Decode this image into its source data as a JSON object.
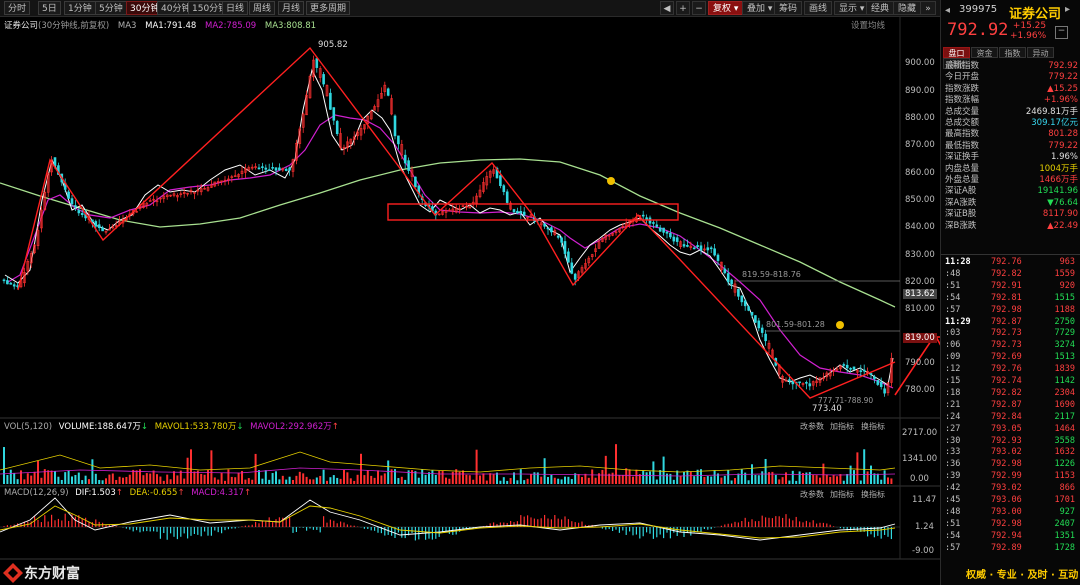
{
  "toolbar": {
    "period_tabs": [
      "分时",
      "5日",
      "1分钟",
      "5分钟",
      "30分钟",
      "40分钟",
      "150分钟",
      "日线",
      "周线",
      "月线",
      "更多周期"
    ],
    "active_tab": "30分钟",
    "tools": [
      "复权",
      "叠加",
      "筹码",
      "画线",
      "显示",
      "经典"
    ],
    "zoom_label": "隐藏"
  },
  "main_chart": {
    "title": "证券公司",
    "subtitle": "(30分钟线,前复权)",
    "ma_label": "MA3",
    "ma1": "MA1:791.48",
    "ma2": "MA2:785.09",
    "ma3": "MA3:808.81",
    "settings": "设置均线",
    "y_ticks": [
      "900.00",
      "890.00",
      "880.00",
      "870.00",
      "860.00",
      "850.00",
      "840.00",
      "830.00",
      "820.00",
      "810.00",
      "800.00",
      "790.00",
      "780.00"
    ],
    "high_label": "905.82",
    "low_label": "773.40",
    "low_label2": "777.71-788.90",
    "range1": "819.59-818.76",
    "range2": "801.59-801.28",
    "price_tag_1": "813.62",
    "price_tag_2": "819.00",
    "colors": {
      "ma1": "#ffffff",
      "ma2": "#d020d0",
      "ma3": "#a8e090",
      "up": "#ff3030",
      "down": "#30d8e0",
      "annotation": "#ff2020"
    }
  },
  "vol_panel": {
    "label": "VOL(5,120)",
    "volume": "VOLUME:188.647万",
    "mavol1": "MAVOL1:533.780万",
    "mavol2": "MAVOL2:292.962万",
    "y_ticks": [
      "2717.00",
      "1341.00",
      "0.00"
    ],
    "buttons": [
      "改参数",
      "加指标",
      "换指标"
    ]
  },
  "macd_panel": {
    "label": "MACD(12,26,9)",
    "dif": "DIF:1.503",
    "dea": "DEA:-0.655",
    "macd": "MACD:4.317",
    "y_ticks": [
      "11.47",
      "1.24",
      "-9.00"
    ],
    "buttons": [
      "改参数",
      "加指标",
      "换指标"
    ]
  },
  "right_panel": {
    "code": "399975",
    "name": "证券公司",
    "price": "792.92",
    "change": "+15.25",
    "change_pct": "+1.96%",
    "subtabs": [
      "盘口",
      "资金",
      "指数",
      "异动",
      "领张"
    ],
    "stats": [
      {
        "k": "最新指数",
        "v": "792.92",
        "c": "red"
      },
      {
        "k": "今日开盘",
        "v": "779.22",
        "c": "red"
      },
      {
        "k": "指数涨跌",
        "v": "▲15.25",
        "c": "red"
      },
      {
        "k": "指数涨幅",
        "v": "+1.96%",
        "c": "red"
      },
      {
        "k": "总成交量",
        "v": "2469.81万手",
        "c": "wht"
      },
      {
        "k": "总成交额",
        "v": "309.17亿元",
        "c": "cyan"
      },
      {
        "k": "最高指数",
        "v": "801.28",
        "c": "red"
      },
      {
        "k": "最低指数",
        "v": "779.22",
        "c": "red"
      },
      {
        "k": "深证换手",
        "v": "1.96%",
        "c": "wht"
      },
      {
        "k": "内盘总量",
        "v": "1004万手",
        "c": "yel"
      },
      {
        "k": "外盘总量",
        "v": "1466万手",
        "c": "red"
      },
      {
        "k": "深证A股",
        "v": "19141.96",
        "c": "grn"
      },
      {
        "k": "深A涨跌",
        "v": "▼76.64",
        "c": "grn"
      },
      {
        "k": "深证B股",
        "v": "8117.90",
        "c": "red"
      },
      {
        "k": "深B涨跌",
        "v": "▲22.49",
        "c": "red"
      }
    ],
    "ticks": [
      {
        "t": "11:28",
        "p": "792.76",
        "v": "963",
        "c": "red",
        "b": true
      },
      {
        "t": ":48",
        "p": "792.82",
        "v": "1559",
        "c": "red"
      },
      {
        "t": ":51",
        "p": "792.91",
        "v": "920",
        "c": "red"
      },
      {
        "t": ":54",
        "p": "792.81",
        "v": "1515",
        "c": "grn"
      },
      {
        "t": ":57",
        "p": "792.98",
        "v": "1188",
        "c": "red"
      },
      {
        "t": "11:29",
        "p": "792.87",
        "v": "2750",
        "c": "grn",
        "b": true
      },
      {
        "t": ":03",
        "p": "792.73",
        "v": "7729",
        "c": "grn"
      },
      {
        "t": ":06",
        "p": "792.73",
        "v": "3274",
        "c": "grn"
      },
      {
        "t": ":09",
        "p": "792.69",
        "v": "1513",
        "c": "grn"
      },
      {
        "t": ":12",
        "p": "792.76",
        "v": "1839",
        "c": "red"
      },
      {
        "t": ":15",
        "p": "792.74",
        "v": "1142",
        "c": "grn"
      },
      {
        "t": ":18",
        "p": "792.82",
        "v": "2304",
        "c": "red"
      },
      {
        "t": ":21",
        "p": "792.87",
        "v": "1690",
        "c": "red"
      },
      {
        "t": ":24",
        "p": "792.84",
        "v": "2117",
        "c": "grn"
      },
      {
        "t": ":27",
        "p": "793.05",
        "v": "1464",
        "c": "red"
      },
      {
        "t": ":30",
        "p": "792.93",
        "v": "3558",
        "c": "grn"
      },
      {
        "t": ":33",
        "p": "793.02",
        "v": "1632",
        "c": "red"
      },
      {
        "t": ":36",
        "p": "792.98",
        "v": "1226",
        "c": "grn"
      },
      {
        "t": ":39",
        "p": "792.99",
        "v": "1153",
        "c": "red"
      },
      {
        "t": ":42",
        "p": "793.02",
        "v": "866",
        "c": "red"
      },
      {
        "t": ":45",
        "p": "793.06",
        "v": "1701",
        "c": "red"
      },
      {
        "t": ":48",
        "p": "793.00",
        "v": "927",
        "c": "grn"
      },
      {
        "t": ":51",
        "p": "792.98",
        "v": "2407",
        "c": "grn"
      },
      {
        "t": ":54",
        "p": "792.94",
        "v": "1351",
        "c": "grn"
      },
      {
        "t": ":57",
        "p": "792.89",
        "v": "1728",
        "c": "grn"
      }
    ]
  },
  "footer": {
    "brand": "东方财富",
    "slogan": "权威 · 专业 · 及时 · 互动"
  }
}
